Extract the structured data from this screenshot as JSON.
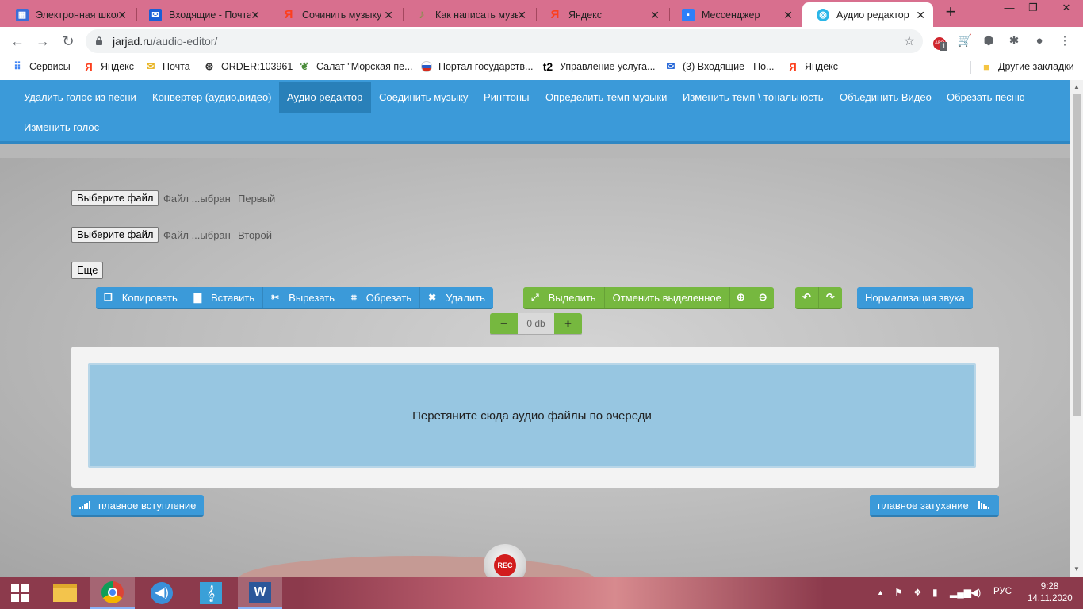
{
  "browser": {
    "tabs": [
      {
        "title": "Электронная школа",
        "favicon": "calendar-icon",
        "color": "#3b6ed8",
        "left": 0
      },
      {
        "title": "Входящие - Почта",
        "favicon": "mail-icon",
        "color": "#1a5fd6",
        "left": 0
      },
      {
        "title": "Сочинить музыку",
        "favicon": "yandex-icon",
        "color": "#fc3f1d",
        "left": 0
      },
      {
        "title": "Как написать музыку",
        "favicon": "music-note-icon",
        "color": "#5aa02c",
        "left": 0
      },
      {
        "title": "Яндекс",
        "favicon": "yandex-icon",
        "color": "#fc3f1d",
        "left": 0
      },
      {
        "title": "Мессенджер",
        "favicon": "chat-icon",
        "color": "#2d7ff9",
        "left": 0
      },
      {
        "title": "Аудио редактор онлайн",
        "favicon": "audio-icon",
        "color": "#2bb6e8",
        "left": 0,
        "active": true
      }
    ],
    "url_host": "jarjad.ru",
    "url_path": "/audio-editor/",
    "extension_badge": "1"
  },
  "bookmarks": [
    {
      "label": "Сервисы",
      "icon": "apps-grid-icon"
    },
    {
      "label": "Яндекс",
      "icon": "yandex-icon"
    },
    {
      "label": "Почта",
      "icon": "mail-envelope-icon"
    },
    {
      "label": "ORDER:103961",
      "icon": "order-icon"
    },
    {
      "label": "Салат \"Морская пе...",
      "icon": "salad-icon"
    },
    {
      "label": "Портал государств...",
      "icon": "russia-flag-icon"
    },
    {
      "label": "Управление услуга...",
      "icon": "t2-icon"
    },
    {
      "label": "(3) Входящие - По...",
      "icon": "mail-icon"
    },
    {
      "label": "Яндекс",
      "icon": "yandex-icon"
    },
    {
      "label": "Другие закладки",
      "icon": "folder-icon"
    }
  ],
  "site_nav": [
    "Удалить голос из песни",
    "Конвертер (аудио,видео)",
    "Аудио редактор",
    "Соединить музыку",
    "Рингтоны",
    "Определить темп музыки",
    "Изменить темп \\ тональность",
    "Объединить Видео",
    "Обрезать песню",
    "Изменить голос"
  ],
  "file_inputs": [
    {
      "button": "Выберите файл",
      "status": "Файл ...ыбран",
      "label": "Первый"
    },
    {
      "button": "Выберите файл",
      "status": "Файл ...ыбран",
      "label": "Второй"
    }
  ],
  "more_button": "Еще",
  "toolbar": {
    "edit": [
      "Копировать",
      "Вставить",
      "Вырезать",
      "Обрезать",
      "Удалить"
    ],
    "select": [
      "Выделить",
      "Отменить выделенное"
    ],
    "normalize": "Нормализация звука"
  },
  "gain": {
    "value": "0 db"
  },
  "dropzone_text": "Перетяните сюда аудио файлы по очереди",
  "fade_in": "плавное вступление",
  "fade_out": "плавное затухание",
  "rec_label": "REC",
  "taskbar": {
    "lang": "РУС",
    "time": "9:28",
    "date": "14.11.2020"
  }
}
